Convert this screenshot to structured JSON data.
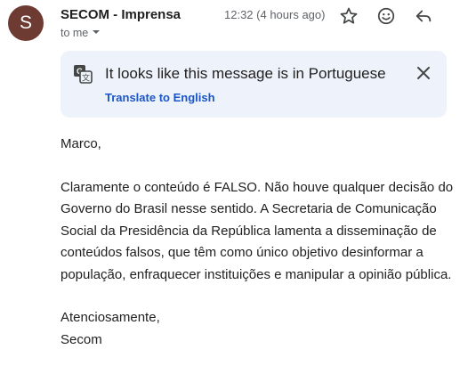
{
  "email": {
    "avatar_letter": "S",
    "sender": "SECOM - Imprensa",
    "recipient": "to me",
    "timestamp": "12:32 (4 hours ago)",
    "actions": {
      "star_icon": "star-outline-icon",
      "react_icon": "emoji-smile-icon",
      "reply_icon": "reply-icon"
    }
  },
  "translate_bar": {
    "icon": "translate-icon",
    "message": "It looks like this message is in Portuguese",
    "link": "Translate to English",
    "close_icon": "close-icon"
  },
  "body": {
    "greeting": "Marco,",
    "paragraph_lines": [
      "Claramente o conteúdo é FALSO. Não houve qualquer decisão do",
      "Governo do Brasil nesse sentido. A Secretaria de Comunicação",
      "Social da Presidência da República lamenta a disseminação de",
      "conteúdos falsos, que têm como único objetivo desinformar a",
      "população, enfraquecer instituições e manipular a opinião pública."
    ],
    "signoff": "Atenciosamente,",
    "signature": "Secom"
  },
  "colors": {
    "avatar_bg": "#6e3b32",
    "translate_bg": "#eef3fb",
    "link": "#1a56c9",
    "muted_text": "#5f6368"
  }
}
